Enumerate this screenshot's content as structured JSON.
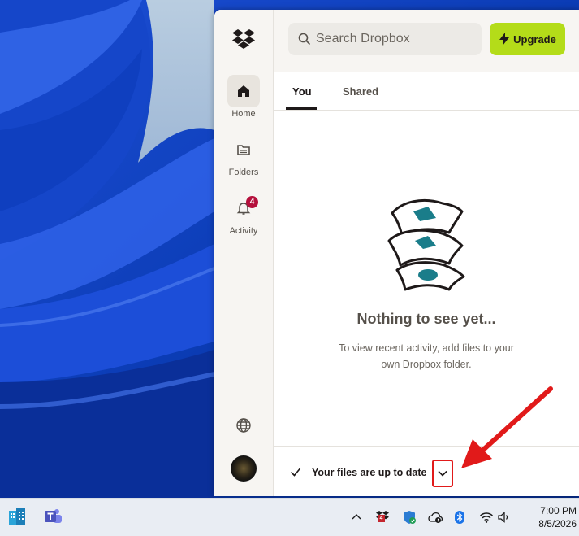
{
  "search": {
    "placeholder": "Search Dropbox"
  },
  "upgrade": {
    "label": "Upgrade"
  },
  "rail": {
    "items": [
      {
        "label": "Home",
        "icon": "home-icon",
        "active": true
      },
      {
        "label": "Folders",
        "icon": "folder-icon"
      },
      {
        "label": "Activity",
        "icon": "bell-icon",
        "badge": "4"
      }
    ]
  },
  "tabs": [
    {
      "label": "You",
      "selected": true
    },
    {
      "label": "Shared"
    }
  ],
  "empty_state": {
    "title": "Nothing to see yet...",
    "description": "To view recent activity, add files to your own Dropbox folder."
  },
  "status": {
    "text": "Your files are up to date"
  },
  "taskbar": {
    "tray_badge": "4",
    "time": "7:00 PM",
    "date": "8/5/2026"
  },
  "colors": {
    "upgrade_bg": "#b4dc19",
    "badge_bg": "#b5103c",
    "annotation_red": "#e11a1a",
    "illustration_teal": "#1a7d8a"
  }
}
